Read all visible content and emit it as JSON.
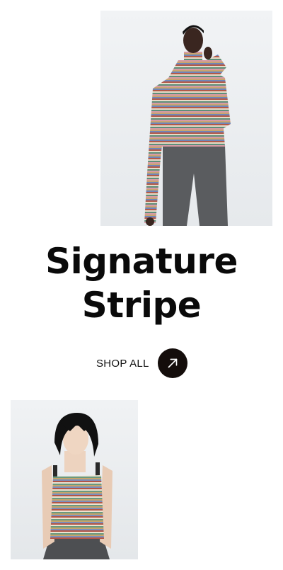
{
  "hero_top_image": {
    "alt": "Model wearing a multicolour striped turtleneck and grey trousers",
    "icon": "photo-striped-turtleneck"
  },
  "headline": {
    "line1": "Signature",
    "line2": "Stripe"
  },
  "cta": {
    "label": "SHOP ALL",
    "icon": "arrow-up-right-icon",
    "circle_color": "#140d0b"
  },
  "hero_bottom_image": {
    "alt": "Model wearing a multicolour striped vest top",
    "icon": "photo-striped-vest"
  }
}
